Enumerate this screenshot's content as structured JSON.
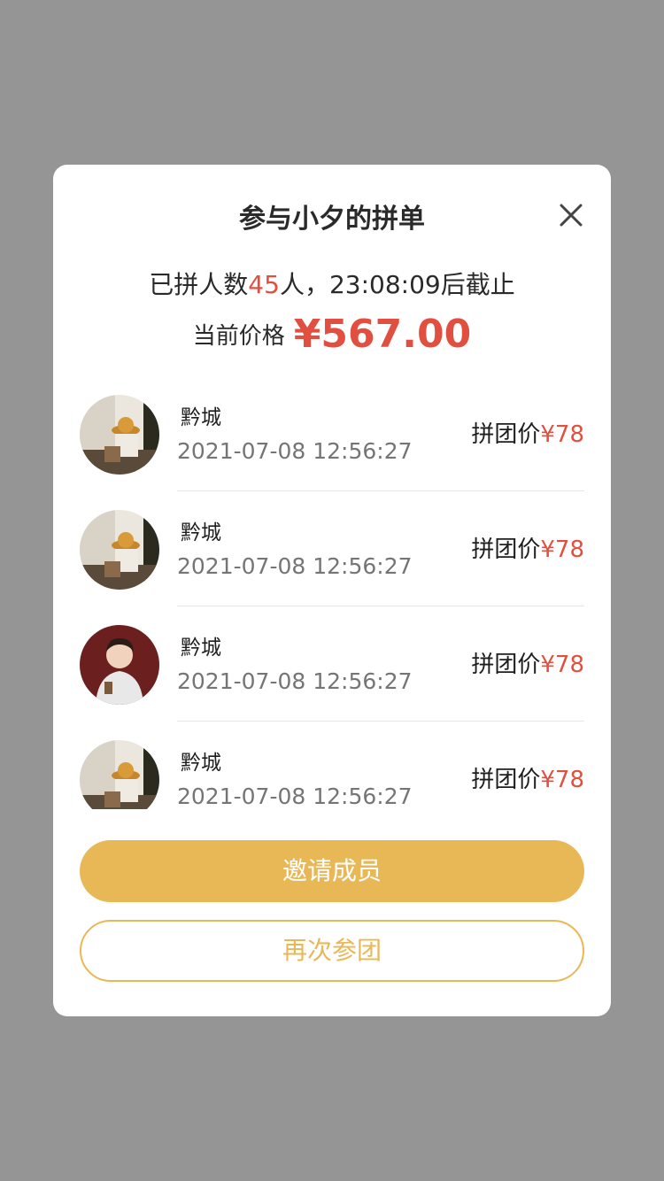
{
  "dialog": {
    "title": "参与小夕的拼单",
    "summary_prefix": "已拼人数",
    "participant_count": "45",
    "summary_suffix": "人，23:08:09后截止",
    "price_label": "当前价格",
    "current_price": "¥567.00"
  },
  "participants": [
    {
      "name": "黔城",
      "time": "2021-07-08 12:56:27",
      "price_label": "拼团价",
      "price": "¥78",
      "avatar": "woman-hat-avatar"
    },
    {
      "name": "黔城",
      "time": "2021-07-08 12:56:27",
      "price_label": "拼团价",
      "price": "¥78",
      "avatar": "woman-hat-avatar"
    },
    {
      "name": "黔城",
      "time": "2021-07-08 12:56:27",
      "price_label": "拼团价",
      "price": "¥78",
      "avatar": "man-hoodie-avatar"
    },
    {
      "name": "黔城",
      "time": "2021-07-08 12:56:27",
      "price_label": "拼团价",
      "price": "¥78",
      "avatar": "woman-hat-avatar"
    }
  ],
  "buttons": {
    "invite": "邀请成员",
    "rejoin": "再次参团"
  },
  "colors": {
    "accent": "#e9b856",
    "price_red": "#e04f3f",
    "overlay": "#959595"
  }
}
